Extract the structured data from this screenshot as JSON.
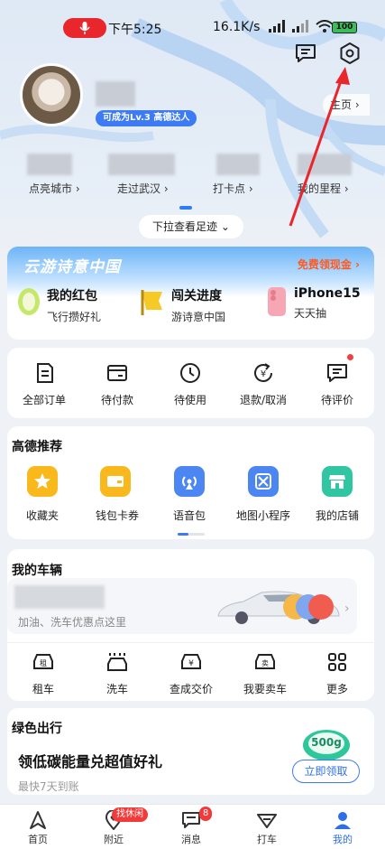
{
  "status_bar": {
    "time": "下午5:25",
    "speed": "16.1K/s",
    "battery": "100"
  },
  "profile": {
    "level_badge": "可成为Lv.3 高德达人",
    "homepage_link": "主页"
  },
  "stats": [
    "点亮城市",
    "走过武汉",
    "打卡点",
    "我的里程"
  ],
  "pull_hint": "下拉查看足迹",
  "promo": {
    "title": "云游诗意中国",
    "link": "免费领现金",
    "items": [
      {
        "title": "我的红包",
        "subtitle": "飞行攒好礼"
      },
      {
        "title": "闯关进度",
        "subtitle": "游诗意中国"
      },
      {
        "title": "iPhone15",
        "subtitle": "天天抽"
      }
    ]
  },
  "orders": [
    "全部订单",
    "待付款",
    "待使用",
    "退款/取消",
    "待评价"
  ],
  "recommend": {
    "title": "高德推荐",
    "apps": [
      "收藏夹",
      "钱包卡券",
      "语音包",
      "地图小程序",
      "我的店铺"
    ]
  },
  "vehicles": {
    "title": "我的车辆",
    "subtitle": "加油、洗车优惠点这里",
    "actions": [
      "租车",
      "洗车",
      "查成交价",
      "我要卖车",
      "更多"
    ]
  },
  "green": {
    "section": "绿色出行",
    "title": "领低碳能量兑超值好礼",
    "subtitle": "最快7天到账",
    "button": "立即领取",
    "coin": "500g"
  },
  "nav": {
    "items": [
      "首页",
      "附近",
      "消息",
      "打车",
      "我的"
    ],
    "nearby_badge": "找休闲",
    "message_badge": "8"
  },
  "colors": {
    "accent": "#3d7bf5",
    "badge": "#f23a3a",
    "promo_link": "#ff5a1f"
  }
}
